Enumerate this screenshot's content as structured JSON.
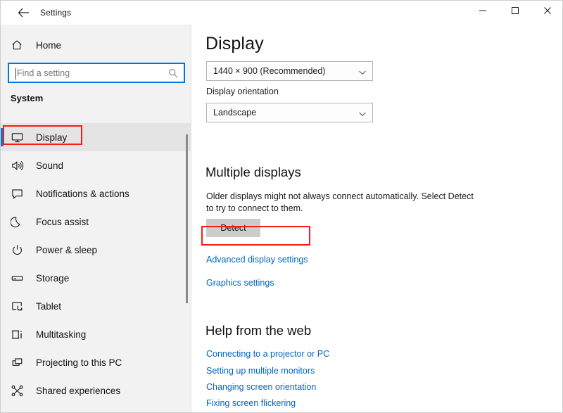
{
  "window": {
    "title": "Settings",
    "back_icon": "back-arrow-icon",
    "controls": {
      "minimize": "minimize-icon",
      "maximize": "maximize-icon",
      "close": "close-icon"
    }
  },
  "sidebar": {
    "home": {
      "label": "Home",
      "icon": "home-icon"
    },
    "search": {
      "placeholder": "Find a setting",
      "value": "",
      "icon": "search-icon"
    },
    "group_header": "System",
    "selected_index": 0,
    "items": [
      {
        "label": "Display",
        "icon": "monitor-icon"
      },
      {
        "label": "Sound",
        "icon": "speaker-icon"
      },
      {
        "label": "Notifications & actions",
        "icon": "notification-bubble-icon"
      },
      {
        "label": "Focus assist",
        "icon": "moon-icon"
      },
      {
        "label": "Power & sleep",
        "icon": "power-icon"
      },
      {
        "label": "Storage",
        "icon": "drive-icon"
      },
      {
        "label": "Tablet",
        "icon": "tablet-touch-icon"
      },
      {
        "label": "Multitasking",
        "icon": "multitasking-icon"
      },
      {
        "label": "Projecting to this PC",
        "icon": "projecting-icon"
      },
      {
        "label": "Shared experiences",
        "icon": "shared-nodes-icon"
      }
    ]
  },
  "main": {
    "title": "Display",
    "resolution": {
      "value": "1440 × 900 (Recommended)",
      "chevron": "chevron-down-icon"
    },
    "orientation": {
      "label": "Display orientation",
      "value": "Landscape",
      "chevron": "chevron-down-icon"
    },
    "multiple_displays": {
      "heading": "Multiple displays",
      "description": "Older displays might not always connect automatically. Select Detect to try to connect to them.",
      "detect_button": "Detect",
      "links": [
        "Advanced display settings",
        "Graphics settings"
      ]
    },
    "help": {
      "heading": "Help from the web",
      "links": [
        "Connecting to a projector or PC",
        "Setting up multiple monitors",
        "Changing screen orientation",
        "Fixing screen flickering"
      ]
    }
  },
  "annotations": {
    "color": "#fb1b0f",
    "targets": [
      "Display",
      "Advanced display settings"
    ]
  },
  "colors": {
    "accent": "#0078d7",
    "link": "#0067c0",
    "sidebar_bg": "#f2f2f2",
    "content_bg": "#ffffff",
    "button_bg": "#cccccc",
    "annotation": "#fb1b0f"
  }
}
